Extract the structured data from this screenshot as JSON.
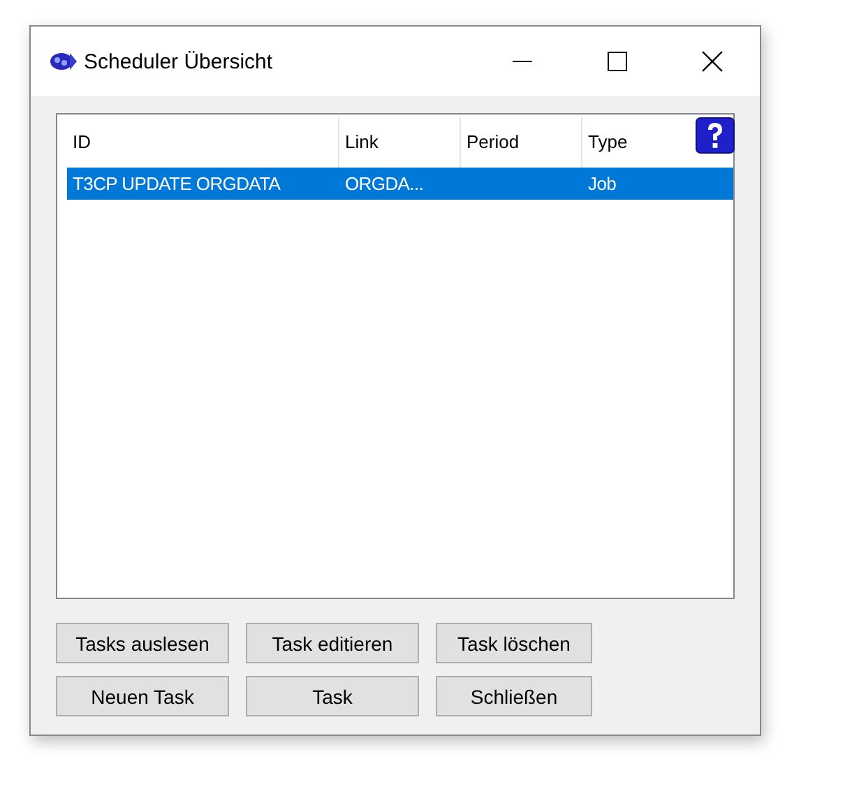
{
  "window": {
    "title": "Scheduler Übersicht"
  },
  "table": {
    "columns": [
      "ID",
      "Link",
      "Period",
      "Type"
    ],
    "rows": [
      {
        "cells": [
          "T3CP UPDATE ORGDATA",
          "ORGDA...",
          "",
          "Job"
        ],
        "selected": true
      }
    ]
  },
  "buttons": [
    {
      "label": "Tasks auslesen"
    },
    {
      "label": "Task editieren"
    },
    {
      "label": "Task löschen"
    },
    {
      "label": "Neuen Task"
    },
    {
      "label": "Task"
    },
    {
      "label": "Schließen"
    }
  ]
}
